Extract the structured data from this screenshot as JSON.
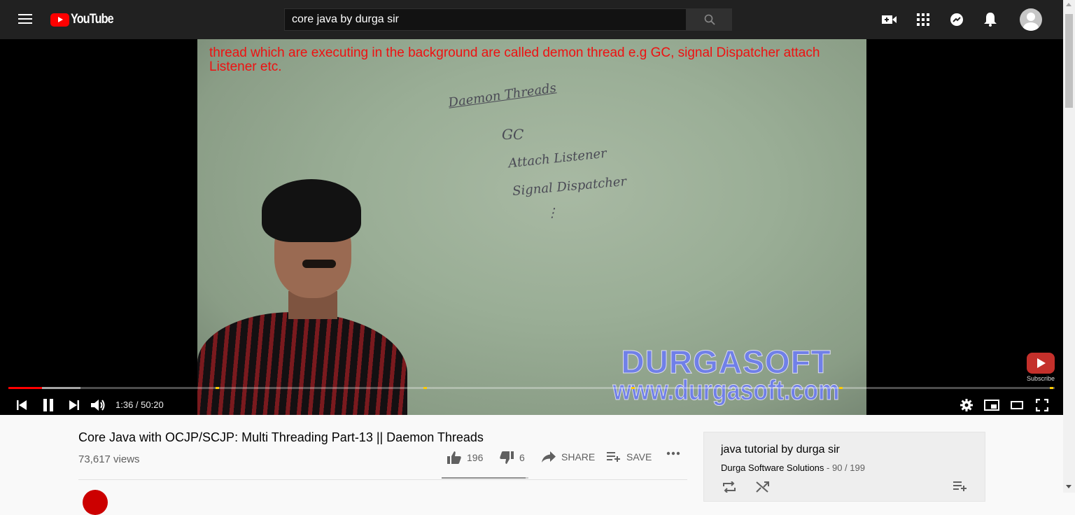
{
  "header": {
    "logo_text": "YouTube",
    "search_value": "core java by durga sir",
    "icons": [
      "menu-icon",
      "search-icon",
      "create-video-icon",
      "apps-icon",
      "messages-icon",
      "notifications-icon",
      "account-avatar"
    ]
  },
  "player": {
    "caption": "thread which are executing in the background are called demon thread e.g GC, signal Dispatcher attach Listener etc.",
    "board": {
      "heading": "Daemon Threads",
      "line1": "GC",
      "line2": "Attach Listener",
      "line3": "Signal Dispatcher",
      "line4": "⋮"
    },
    "watermark": {
      "line1": "DURGASOFT",
      "line2": "www.durgasoft.com"
    },
    "subscribe_label": "Subscribe",
    "time_display": "1:36 / 50:20",
    "progress": {
      "played_fraction": 0.032,
      "buffered_fraction": 0.069
    },
    "accent_color": "#ff0000"
  },
  "video": {
    "title": "Core Java with OCJP/SCJP: Multi Threading Part-13 || Daemon Threads",
    "views": "73,617 views",
    "likes": "196",
    "dislikes": "6",
    "share_label": "SHARE",
    "save_label": "SAVE",
    "like_ratio": 0.97
  },
  "playlist": {
    "title": "java tutorial by durga sir",
    "owner": "Durga Software Solutions",
    "position": " - 90 / 199"
  }
}
